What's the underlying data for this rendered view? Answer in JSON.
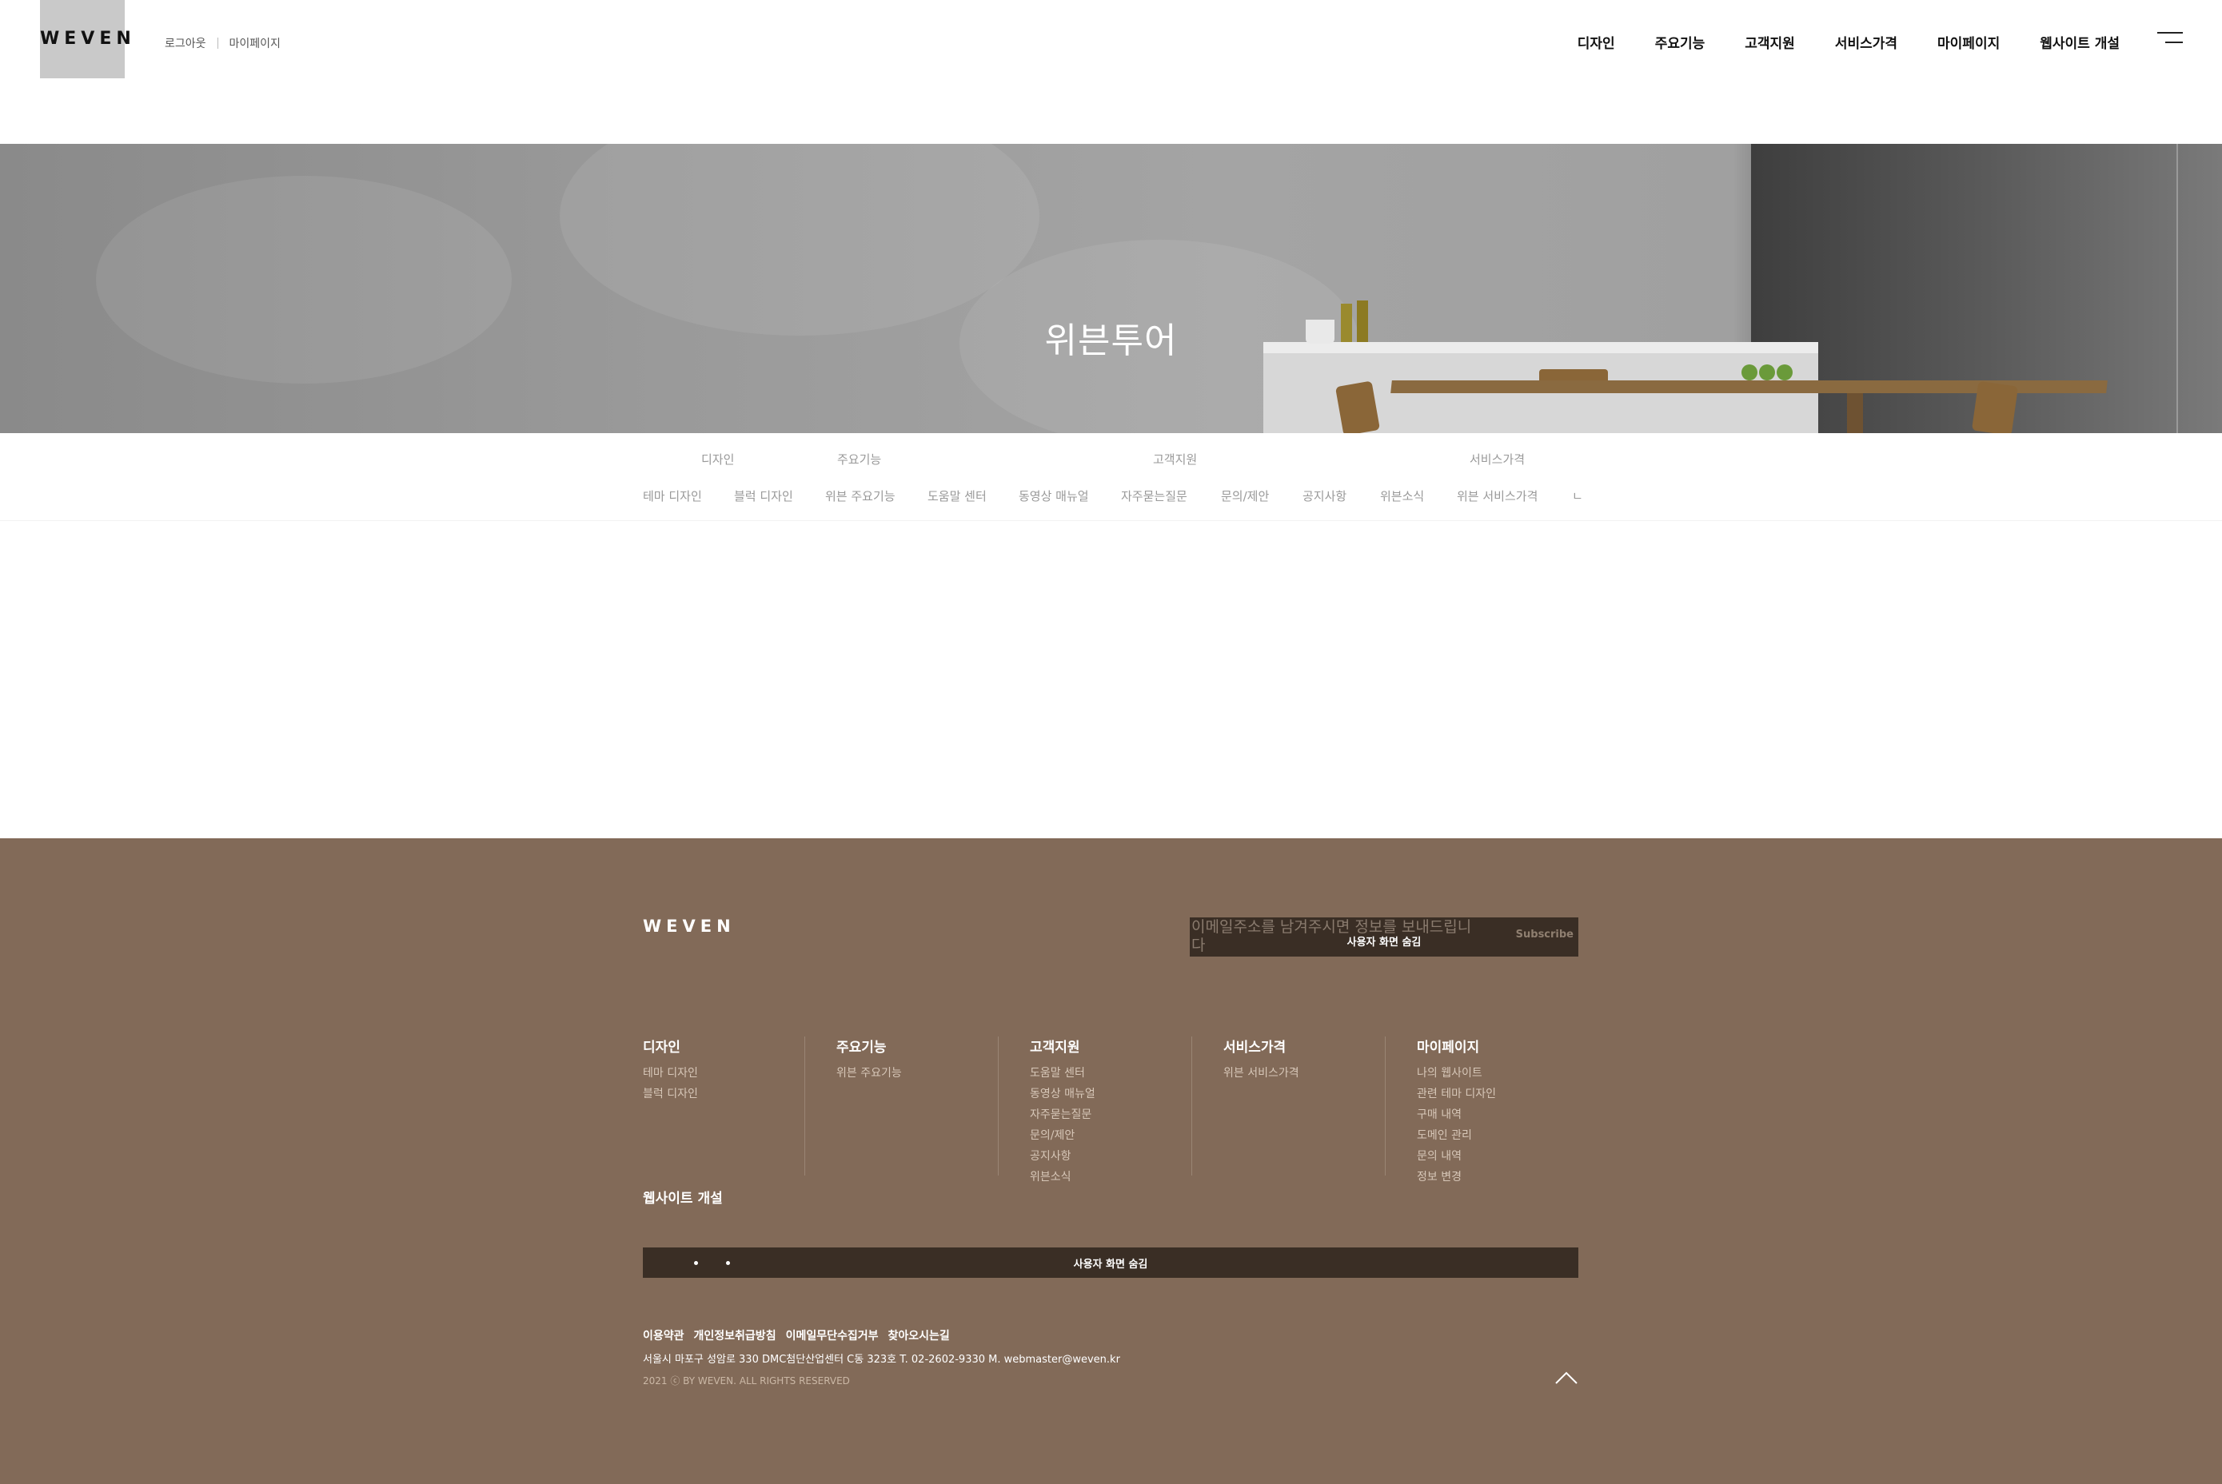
{
  "header": {
    "logo": "WEVEN",
    "util_links": [
      "로그아웃",
      "마이페이지"
    ],
    "nav": [
      "디자인",
      "주요기능",
      "고객지원",
      "서비스가격",
      "마이페이지",
      "웹사이트 개설"
    ]
  },
  "hero": {
    "title": "위븐투어"
  },
  "subnav": {
    "categories": [
      "디자인",
      "주요기능",
      "고객지원",
      "서비스가격"
    ],
    "items": [
      "테마 디자인",
      "블럭 디자인",
      "위븐 주요기능",
      "도움말 센터",
      "동영상 매뉴얼",
      "자주묻는질문",
      "문의/제안",
      "공지사항",
      "위븐소식",
      "위븐 서비스가격",
      "ㄴ"
    ]
  },
  "footer": {
    "logo": "WEVEN",
    "subscribe": {
      "placeholder": "이메일주소를 남겨주시면 정보를 보내드립니다",
      "auth_text": "사용자 화면 숨김",
      "button": "Subscribe"
    },
    "columns": [
      {
        "title": "디자인",
        "links": [
          "테마 디자인",
          "블럭 디자인"
        ]
      },
      {
        "title": "주요기능",
        "links": [
          "위븐 주요기능"
        ]
      },
      {
        "title": "고객지원",
        "links": [
          "도움말 센터",
          "동영상 매뉴얼",
          "자주묻는질문",
          "문의/제안",
          "공지사항",
          "위븐소식"
        ]
      },
      {
        "title": "서비스가격",
        "links": [
          "위븐 서비스가격"
        ]
      },
      {
        "title": "마이페이지",
        "links": [
          "나의 웹사이트",
          "관련 테마 디자인",
          "구매 내역",
          "도메인 관리",
          "문의 내역",
          "정보 변경"
        ]
      }
    ],
    "website_open": "웹사이트 개설",
    "bar_text": "사용자 화면 숨김",
    "policy_links": [
      "이용약관",
      "개인정보취급방침",
      "이메일무단수집거부",
      "찾아오시는길"
    ],
    "address": "서울시 마포구 성암로 330 DMC첨단산업센터 C동 323호   T. 02-2602-9330   M. webmaster@weven.kr",
    "copyright": "2021 ⓒ BY WEVEN. ALL RIGHTS RESERVED"
  }
}
